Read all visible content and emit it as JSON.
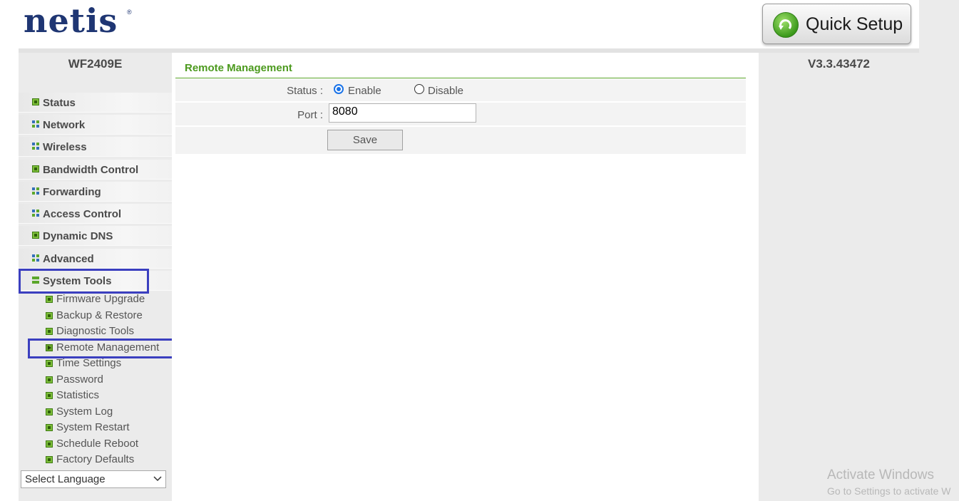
{
  "header": {
    "logo": "netis",
    "logo_mark": "®",
    "quick_setup_label": "Quick Setup",
    "quick_setup_icon": "refresh-arrow-icon"
  },
  "sidebar": {
    "model": "WF2409E",
    "menu": [
      {
        "label": "Status",
        "icon": "single"
      },
      {
        "label": "Network",
        "icon": "grid"
      },
      {
        "label": "Wireless",
        "icon": "grid"
      },
      {
        "label": "Bandwidth Control",
        "icon": "single"
      },
      {
        "label": "Forwarding",
        "icon": "grid"
      },
      {
        "label": "Access Control",
        "icon": "grid"
      },
      {
        "label": "Dynamic DNS",
        "icon": "single"
      },
      {
        "label": "Advanced",
        "icon": "grid"
      },
      {
        "label": "System Tools",
        "icon": "bars",
        "expanded": true
      }
    ],
    "submenu": [
      {
        "label": "Firmware Upgrade"
      },
      {
        "label": "Backup & Restore"
      },
      {
        "label": "Diagnostic Tools"
      },
      {
        "label": "Remote Management",
        "active": true
      },
      {
        "label": "Time Settings"
      },
      {
        "label": "Password"
      },
      {
        "label": "Statistics"
      },
      {
        "label": "System Log"
      },
      {
        "label": "System Restart"
      },
      {
        "label": "Schedule Reboot"
      },
      {
        "label": "Factory Defaults"
      }
    ],
    "language_select": "Select Language"
  },
  "main": {
    "title": "Remote Management",
    "status_label": "Status :",
    "enable_label": "Enable",
    "disable_label": "Disable",
    "status_value": "Enable",
    "port_label": "Port :",
    "port_value": "8080",
    "save_label": "Save"
  },
  "right": {
    "version": "V3.3.43472"
  },
  "watermark": {
    "line1": "Activate Windows",
    "line2": "Go to Settings to activate W"
  },
  "colors": {
    "accent_green": "#4c9a1e",
    "logo_blue": "#1f3673",
    "highlight_box": "#3b3fbf",
    "radio_blue": "#1a73e8"
  }
}
